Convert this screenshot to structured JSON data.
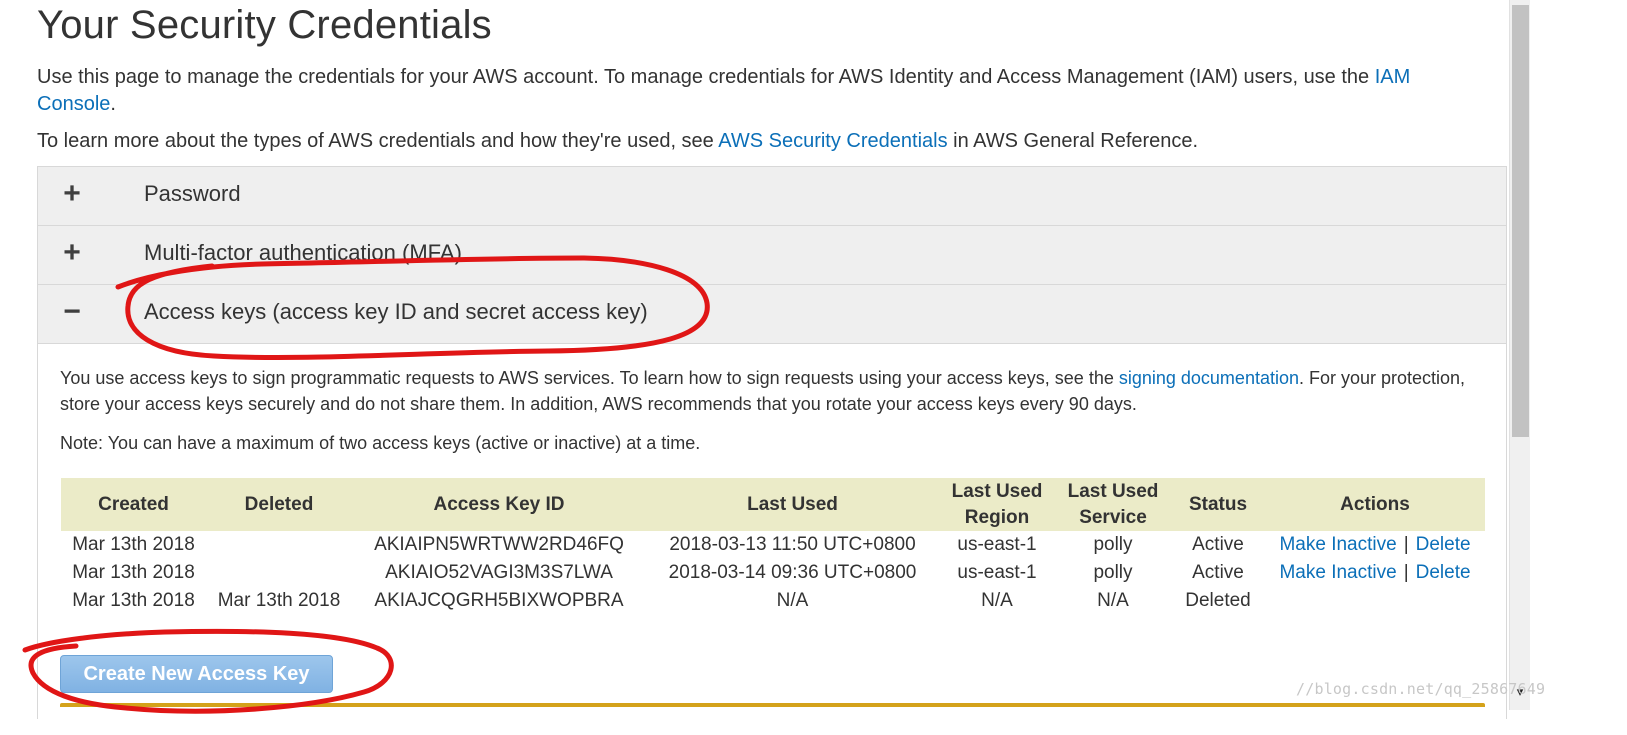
{
  "page": {
    "title": "Your Security Credentials",
    "intro_before_link": "Use this page to manage the credentials for your AWS account. To manage credentials for AWS Identity and Access Management (IAM) users, use the ",
    "iam_console_link": "IAM Console",
    "intro_after_link": ".",
    "reference_before_link": "To learn more about the types of AWS credentials and how they're used, see ",
    "reference_link": "AWS Security Credentials",
    "reference_after_link": " in AWS General Reference."
  },
  "sections": {
    "password": {
      "icon": "+",
      "title": "Password"
    },
    "mfa": {
      "icon": "+",
      "title": "Multi-factor authentication (MFA)"
    },
    "access_keys": {
      "icon": "−",
      "title": "Access keys (access key ID and secret access key)"
    }
  },
  "access_keys": {
    "description_before_link": "You use access keys to sign programmatic requests to AWS services. To learn how to sign requests using your access keys, see the ",
    "signing_link": "signing documentation",
    "description_after_link": ". For your protection, store your access keys securely and do not share them. In addition, AWS recommends that you rotate your access keys every 90 days.",
    "note": "Note: You can have a maximum of two access keys (active or inactive) at a time.",
    "columns": {
      "created": "Created",
      "deleted": "Deleted",
      "access_key_id": "Access Key ID",
      "last_used": "Last Used",
      "last_used_region": "Last Used Region",
      "last_used_service": "Last Used Service",
      "status": "Status",
      "actions": "Actions"
    },
    "rows": [
      {
        "created": "Mar 13th 2018",
        "deleted": "",
        "access_key_id": "AKIAIPN5WRTWW2RD46FQ",
        "last_used": "2018-03-13 11:50 UTC+0800",
        "last_used_region": "us-east-1",
        "last_used_service": "polly",
        "status": "Active",
        "make_inactive": "Make Inactive",
        "separator": "|",
        "delete": "Delete"
      },
      {
        "created": "Mar 13th 2018",
        "deleted": "",
        "access_key_id": "AKIAIO52VAGI3M3S7LWA",
        "last_used": "2018-03-14 09:36 UTC+0800",
        "last_used_region": "us-east-1",
        "last_used_service": "polly",
        "status": "Active",
        "make_inactive": "Make Inactive",
        "separator": "|",
        "delete": "Delete"
      },
      {
        "created": "Mar 13th 2018",
        "deleted": "Mar 13th 2018",
        "access_key_id": "AKIAJCQGRH5BIXWOPBRA",
        "last_used": "N/A",
        "last_used_region": "N/A",
        "last_used_service": "N/A",
        "status": "Deleted",
        "make_inactive": "",
        "separator": "",
        "delete": ""
      }
    ],
    "create_button": "Create New Access Key"
  },
  "watermark": "//blog.csdn.net/qq_25867649",
  "colors": {
    "link": "#0b6fb8",
    "section_header": "#efefef",
    "table_header": "#ebebc8",
    "button": "#8bbbe8",
    "annotation": "#e01616"
  },
  "icons": {
    "expand": "plus-icon",
    "collapse": "minus-icon",
    "scroll_down": "chevron-down-icon"
  }
}
